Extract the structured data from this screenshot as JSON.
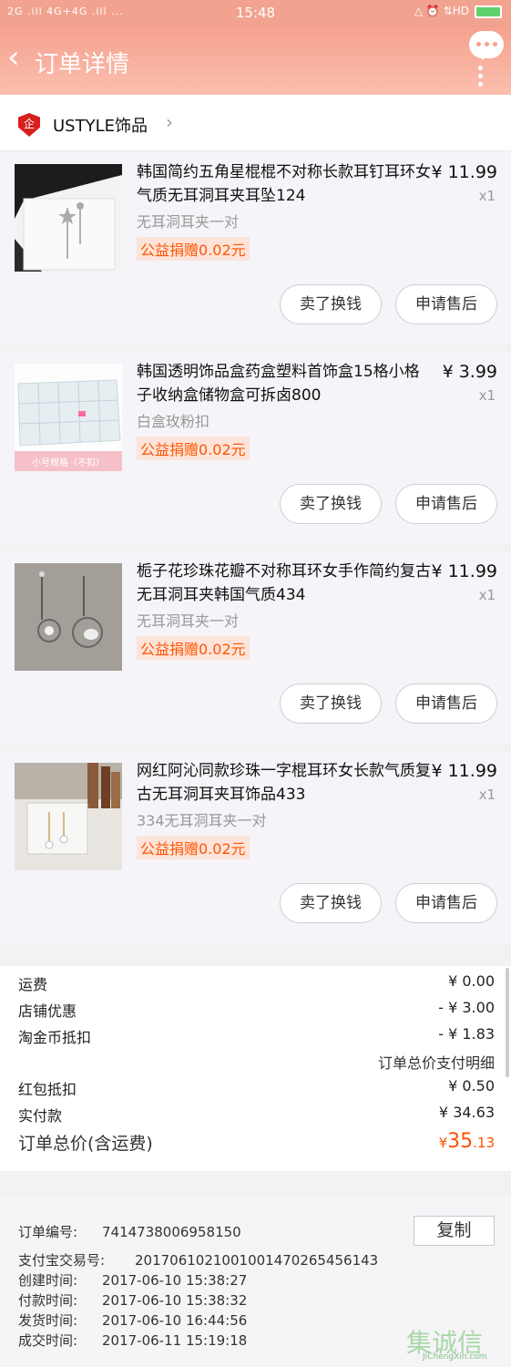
{
  "status_bar": {
    "signal": "2G .ill 4G+4G .ill ...",
    "time": "15:48",
    "right_icons": "△ ⏰ ⇅HD"
  },
  "navbar": {
    "back_label": "‹",
    "title": "订单详情"
  },
  "shop": {
    "badge": "企",
    "name": "USTYLE饰品",
    "chevron": "›"
  },
  "items": [
    {
      "title": "韩国简约五角星棍棍不对称长款耳钉耳环女气质无耳洞耳夹耳坠124",
      "price": "¥ 11.99",
      "qty": "x1",
      "sku": "无耳洞耳夹一对",
      "charity": "公益捐赠0.02元",
      "sell": "卖了换钱",
      "after": "申请售后"
    },
    {
      "title": "韩国透明饰品盒药盒塑料首饰盒15格小格子收纳盒储物盒可拆卤800",
      "price": "¥ 3.99",
      "qty": "x1",
      "sku": "白盒玫粉扣",
      "charity": "公益捐赠0.02元",
      "sell": "卖了换钱",
      "after": "申请售后"
    },
    {
      "title": "栀子花珍珠花瓣不对称耳环女手作简约复古无耳洞耳夹韩国气质434",
      "price": "¥ 11.99",
      "qty": "x1",
      "sku": "无耳洞耳夹一对",
      "charity": "公益捐赠0.02元",
      "sell": "卖了换钱",
      "after": "申请售后"
    },
    {
      "title": "网红阿沁同款珍珠一字棍耳环女长款气质复古无耳洞耳夹耳饰品433",
      "price": "¥ 11.99",
      "qty": "x1",
      "sku": "334无耳洞耳夹一对",
      "charity": "公益捐赠0.02元",
      "sell": "卖了换钱",
      "after": "申请售后"
    }
  ],
  "thumb2_caption": "小号规格（不扣）",
  "summary": {
    "shipping_label": "运费",
    "shipping": "¥ 0.00",
    "shop_discount_label": "店铺优惠",
    "shop_discount": "- ¥ 3.00",
    "coin_label": "淘金币抵扣",
    "coin": "- ¥ 1.83",
    "detail_link": "订单总价支付明细",
    "redpacket_label": "红包抵扣",
    "redpacket": "¥ 0.50",
    "paid_label": "实付款",
    "paid": "¥ 34.63",
    "total_label": "订单总价(含运费)",
    "total_symbol": "¥",
    "total_int": "35",
    "total_dec": ".13"
  },
  "order_info": {
    "order_no_label": "订单编号:",
    "order_no": "7414738006958150",
    "copy_label": "复制",
    "alipay_label": "支付宝交易号:",
    "alipay_no": "2017061021001001470265456143",
    "created_label": "创建时间:",
    "created": "2017-06-10  15:38:27",
    "paid_label": "付款时间:",
    "paid": "2017-06-10  15:38:32",
    "shipped_label": "发货时间:",
    "shipped": "2017-06-10  16:44:56",
    "done_label": "成交时间:",
    "done": "2017-06-11  15:19:18"
  },
  "watermark": {
    "text": "集诚信",
    "sub": "JiChengXin.com"
  }
}
